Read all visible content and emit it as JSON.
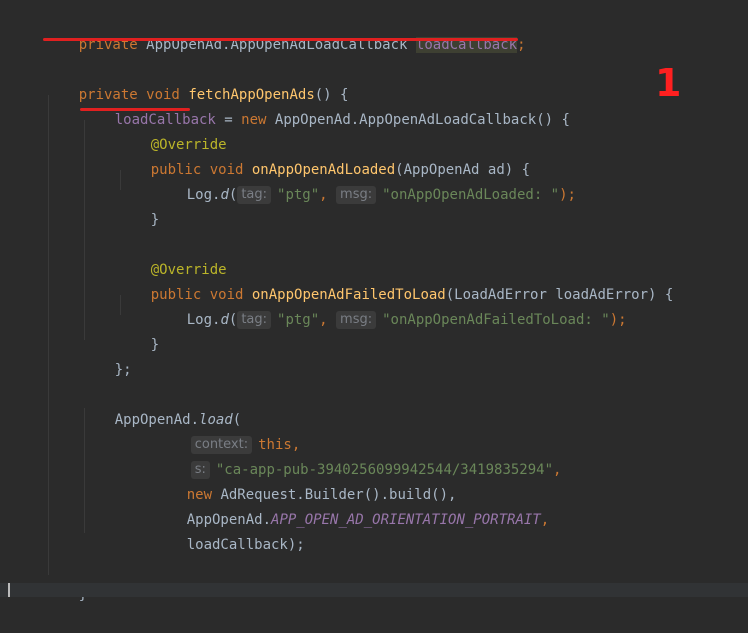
{
  "code": {
    "l1": {
      "mod": "private",
      "type": "AppOpenAd.AppOpenAdLoadCallback",
      "var": "loadCallback",
      "semi": ";"
    },
    "l2": {
      "mod": "private void",
      "method": "fetchAppOpenAds",
      "rest": "() {"
    },
    "l3": {
      "var": "loadCallback",
      "eq": " = ",
      "new": "new",
      "rest": " AppOpenAd.AppOpenAdLoadCallback() {"
    },
    "l4": {
      "ann": "@Override"
    },
    "l5": {
      "mod": "public void",
      "method": "onAppOpenAdLoaded",
      "rest": "(AppOpenAd ad) {"
    },
    "l6": {
      "cls": "Log.",
      "fn": "d",
      "open": "(",
      "hint1": "tag:",
      "str1": "\"ptg\"",
      "comma": ", ",
      "hint2": "msg:",
      "str2": "\"onAppOpenAdLoaded: \"",
      "close": ");"
    },
    "l7": {
      "brace": "}"
    },
    "l8": {
      "ann": "@Override"
    },
    "l9": {
      "mod": "public void",
      "method": "onAppOpenAdFailedToLoad",
      "rest": "(LoadAdError loadAdError) {"
    },
    "l10": {
      "cls": "Log.",
      "fn": "d",
      "open": "(",
      "hint1": "tag:",
      "str1": "\"ptg\"",
      "comma": ", ",
      "hint2": "msg:",
      "str2": "\"onAppOpenAdFailedToLoad: \"",
      "close": ");"
    },
    "l11": {
      "brace": "}"
    },
    "l12": {
      "brace": "};"
    },
    "l13": {
      "cls": "AppOpenAd.",
      "fn": "load",
      "open": "("
    },
    "l14": {
      "hint": "context:",
      "kw": "this",
      "comma": ","
    },
    "l15": {
      "hint": "s:",
      "str": "\"ca-app-pub-3940256099942544/3419835294\"",
      "comma": ","
    },
    "l16": {
      "new": "new",
      "rest": " AdRequest.Builder().build(),"
    },
    "l17": {
      "cls": "AppOpenAd.",
      "const": "APP_OPEN_AD_ORIENTATION_PORTRAIT",
      "comma": ","
    },
    "l18": {
      "rest": "loadCallback);"
    },
    "l19": {
      "brace": "}"
    }
  },
  "marker": "1",
  "colors": {
    "background": "#2b2b2b",
    "keyword": "#cc7832",
    "method": "#ffc66d",
    "string": "#6a8759",
    "annotation": "#bbb529",
    "underline": "#e02020",
    "marker": "#ff2020"
  }
}
